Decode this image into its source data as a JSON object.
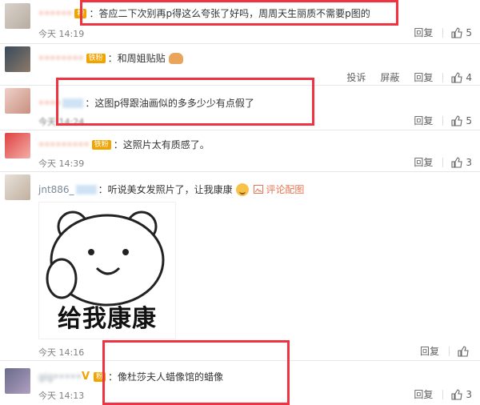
{
  "comments": [
    {
      "username": "••••••",
      "text": "：答应二下次别再p得这么夸张了好吗，周周天生丽质不需要p图的",
      "time": "今天 14:19",
      "reply": "回复",
      "likes": "5"
    },
    {
      "username": "••••••••",
      "badge": "铁粉",
      "text": "：和周姐贴贴",
      "report": "投诉",
      "block": "屏蔽",
      "reply": "回复",
      "likes": "4"
    },
    {
      "username": "••••",
      "text": "：这图p得跟油画似的多多少少有点假了",
      "time": "今天 14:24",
      "reply": "回复",
      "likes": "5"
    },
    {
      "username": "•••••••••",
      "badge": "铁粉",
      "text": "：这照片太有质感了。",
      "time": "今天 14:39",
      "reply": "回复",
      "likes": "3"
    },
    {
      "username": "jnt886_",
      "text": "：听说美女发照片了，让我康康",
      "link": "评论配图",
      "sticker_caption": "给我康康",
      "time": "今天 14:16",
      "reply": "回复"
    },
    {
      "username": "gig•••••",
      "badge_v": "V",
      "text": "：像杜莎夫人蜡像馆的蜡像",
      "time": "今天 14:13",
      "reply": "回复",
      "likes": "3"
    }
  ],
  "colors": {
    "annotation_box": "#ef3340",
    "username": "#eb7350",
    "meta": "#808080"
  },
  "icons": {
    "like": "thumbs-up-icon"
  }
}
